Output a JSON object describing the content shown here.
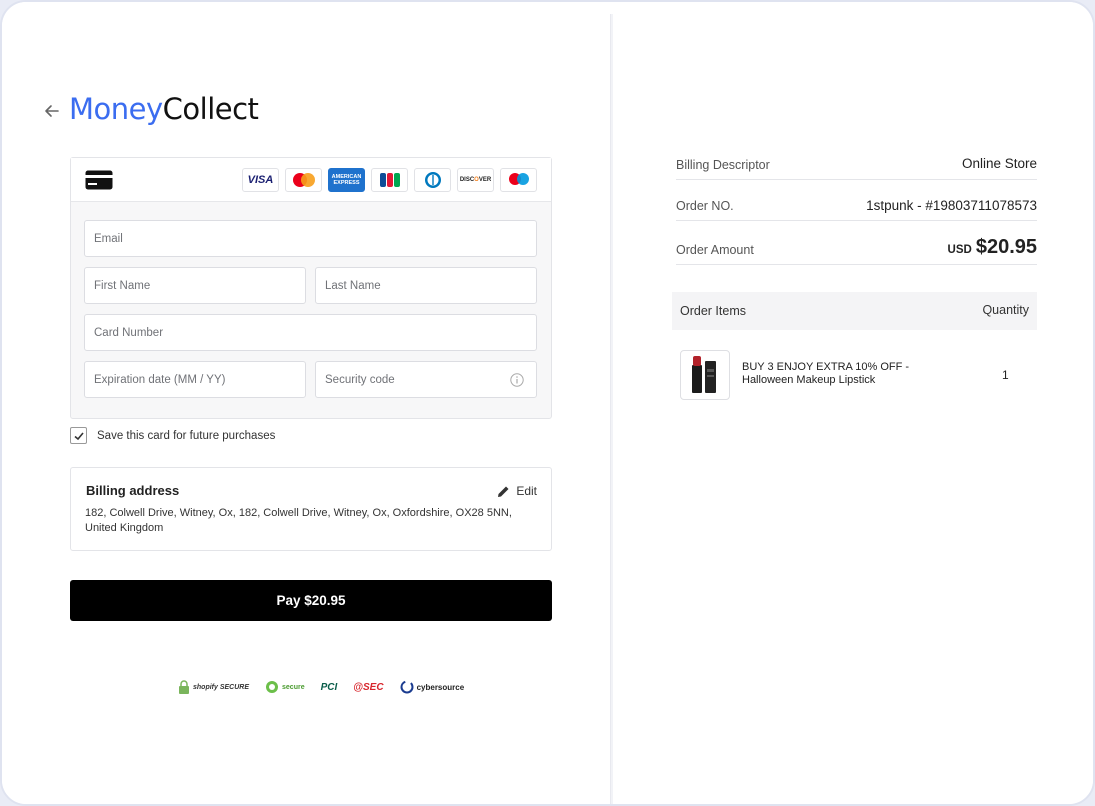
{
  "header": {
    "logo_part1": "Money",
    "logo_part2": "Collect"
  },
  "card_form": {
    "brands": [
      "VISA",
      "Mastercard",
      "American Express",
      "JCB",
      "Diners Club",
      "DISCOVER",
      "Maestro"
    ],
    "email_placeholder": "Email",
    "first_name_placeholder": "First Name",
    "last_name_placeholder": "Last Name",
    "card_number_placeholder": "Card Number",
    "expiration_placeholder": "Expiration date (MM / YY)",
    "security_placeholder": "Security code"
  },
  "save_card": {
    "label": "Save this card for future purchases",
    "checked": true
  },
  "billing": {
    "title": "Billing address",
    "edit_label": "Edit",
    "address": "182, Colwell Drive, Witney, Ox, 182, Colwell Drive, Witney, Ox, Oxfordshire, OX28 5NN, United Kingdom"
  },
  "pay_button": "Pay $20.95",
  "trust_badges": [
    "shopify SECURE",
    "secure",
    "PCI",
    "@SEC",
    "cybersource"
  ],
  "order": {
    "descriptor_label": "Billing Descriptor",
    "descriptor_value": "Online Store",
    "order_no_label": "Order NO.",
    "order_no_value": "1stpunk - #19803711078573",
    "amount_label": "Order Amount",
    "amount_currency": "USD",
    "amount_value": "$20.95",
    "items_label": "Order Items",
    "quantity_label": "Quantity",
    "items": [
      {
        "name": "BUY 3 ENJOY EXTRA 10% OFF - Halloween Makeup Lipstick",
        "quantity": "1"
      }
    ]
  },
  "colors": {
    "brand_blue": "#3b6df0",
    "pay_button": "#000000"
  }
}
